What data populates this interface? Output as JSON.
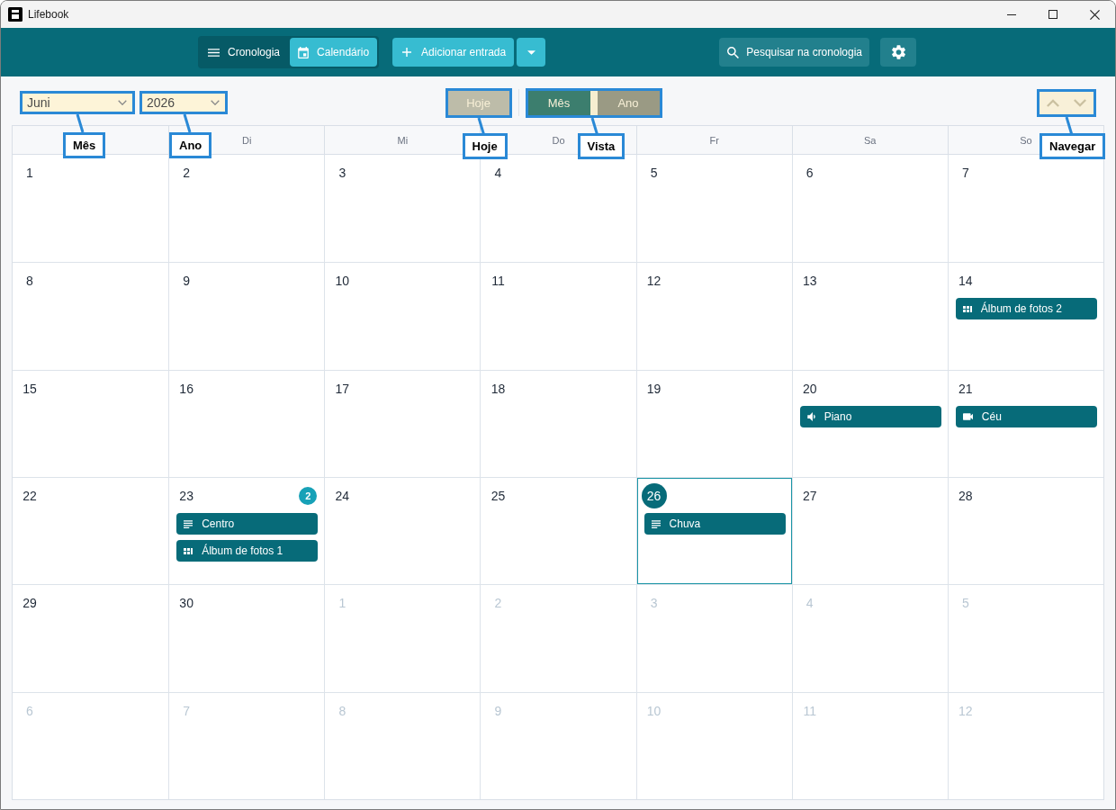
{
  "window": {
    "title": "Lifebook"
  },
  "toolbar": {
    "view_switch": [
      {
        "label": "Cronologia",
        "kind": "list",
        "selected": false
      },
      {
        "label": "Calendário",
        "kind": "calendar",
        "selected": true
      }
    ],
    "add_button": {
      "label": "Adicionar entrada"
    },
    "search_button": {
      "label": "Pesquisar na cronologia"
    }
  },
  "controls": {
    "month_select": {
      "value": "Juni",
      "callout": "Mês"
    },
    "year_select": {
      "value": "2026",
      "callout": "Ano"
    },
    "today_button": {
      "label": "Hoje",
      "disabled": true,
      "callout": "Hoje"
    },
    "view_toggle": {
      "options": [
        {
          "label": "Mês",
          "selected": true
        },
        {
          "label": "Ano",
          "selected": false
        }
      ],
      "callout": "Vista"
    },
    "navigation": {
      "callout": "Navegar"
    }
  },
  "calendar": {
    "weekdays": [
      "Di",
      "Mi",
      "Do",
      "Fr",
      "Sa",
      "So"
    ],
    "weeks": [
      [
        {
          "day": "1",
          "outside": false,
          "today": false
        },
        {
          "day": "2",
          "outside": false,
          "today": false
        },
        {
          "day": "3",
          "outside": false,
          "today": false
        },
        {
          "day": "4",
          "outside": false,
          "today": false
        },
        {
          "day": "5",
          "outside": false,
          "today": false
        },
        {
          "day": "6",
          "outside": false,
          "today": false
        },
        {
          "day": "7",
          "outside": false,
          "today": false
        }
      ],
      [
        {
          "day": "8",
          "outside": false,
          "today": false
        },
        {
          "day": "9",
          "outside": false,
          "today": false
        },
        {
          "day": "10",
          "outside": false,
          "today": false
        },
        {
          "day": "11",
          "outside": false,
          "today": false
        },
        {
          "day": "12",
          "outside": false,
          "today": false
        },
        {
          "day": "13",
          "outside": false,
          "today": false
        },
        {
          "day": "14",
          "outside": false,
          "today": false,
          "events": [
            {
              "label": "Álbum de fotos 2",
              "kind": "album"
            }
          ]
        }
      ],
      [
        {
          "day": "15",
          "outside": false,
          "today": false
        },
        {
          "day": "16",
          "outside": false,
          "today": false
        },
        {
          "day": "17",
          "outside": false,
          "today": false
        },
        {
          "day": "18",
          "outside": false,
          "today": false
        },
        {
          "day": "19",
          "outside": false,
          "today": false
        },
        {
          "day": "20",
          "outside": false,
          "today": false,
          "events": [
            {
              "label": "Piano",
              "kind": "audio"
            }
          ]
        },
        {
          "day": "21",
          "outside": false,
          "today": false,
          "events": [
            {
              "label": "Céu",
              "kind": "video"
            }
          ]
        }
      ],
      [
        {
          "day": "22",
          "outside": false,
          "today": false
        },
        {
          "day": "23",
          "outside": false,
          "today": false,
          "badge": "2",
          "events": [
            {
              "label": "Centro",
              "kind": "text"
            },
            {
              "label": "Álbum de fotos 1",
              "kind": "album"
            }
          ]
        },
        {
          "day": "24",
          "outside": false,
          "today": false
        },
        {
          "day": "25",
          "outside": false,
          "today": false
        },
        {
          "day": "26",
          "outside": false,
          "today": true,
          "events": [
            {
              "label": "Chuva",
              "kind": "text"
            }
          ]
        },
        {
          "day": "27",
          "outside": false,
          "today": false
        },
        {
          "day": "28",
          "outside": false,
          "today": false
        }
      ],
      [
        {
          "day": "29",
          "outside": false,
          "today": false
        },
        {
          "day": "30",
          "outside": false,
          "today": false
        },
        {
          "day": "1",
          "outside": true,
          "today": false
        },
        {
          "day": "2",
          "outside": true,
          "today": false
        },
        {
          "day": "3",
          "outside": true,
          "today": false
        },
        {
          "day": "4",
          "outside": true,
          "today": false
        },
        {
          "day": "5",
          "outside": true,
          "today": false
        }
      ],
      [
        {
          "day": "6",
          "outside": true,
          "today": false
        },
        {
          "day": "7",
          "outside": true,
          "today": false
        },
        {
          "day": "8",
          "outside": true,
          "today": false
        },
        {
          "day": "9",
          "outside": true,
          "today": false
        },
        {
          "day": "10",
          "outside": true,
          "today": false
        },
        {
          "day": "11",
          "outside": true,
          "today": false
        },
        {
          "day": "12",
          "outside": true,
          "today": false
        }
      ]
    ]
  }
}
